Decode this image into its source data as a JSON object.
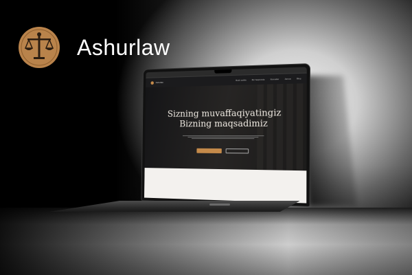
{
  "brand": {
    "name": "Ashurlaw",
    "accent_color": "#c48a4a",
    "logo_icon": "scales-of-justice-icon"
  },
  "website": {
    "nav": {
      "brand": "Ashurlaw",
      "links": [
        "Bosh sahifa",
        "Biz haqimizda",
        "Xizmatlar",
        "Jamoa",
        "Blog"
      ]
    },
    "hero": {
      "title_line1": "Sizning muvaffaqiyatingiz",
      "title_line2": "Bizning maqsadimiz",
      "primary_button": "",
      "secondary_button": ""
    }
  }
}
